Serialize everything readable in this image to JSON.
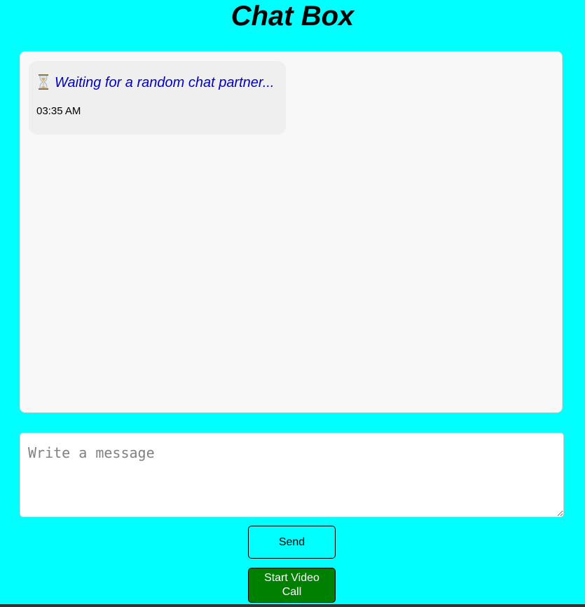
{
  "app": {
    "title": "Chat Box"
  },
  "chat": {
    "messages": [
      {
        "icon": "hourglass-icon",
        "text": "Waiting for a random chat partner...",
        "time": "03:35 AM",
        "text_color": "#0000cc"
      }
    ]
  },
  "composer": {
    "placeholder": "Write a message",
    "value": ""
  },
  "actions": {
    "send_label": "Send",
    "video_label": "Start Video Call"
  },
  "colors": {
    "page_background": "#00ffff",
    "video_button": "#008000",
    "chat_background": "#f8f8f8",
    "bubble_background": "#efefef"
  }
}
